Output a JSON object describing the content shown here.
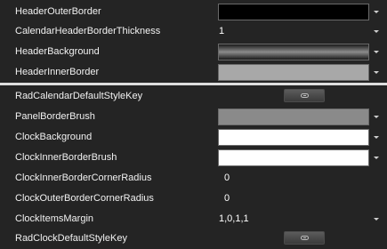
{
  "rows": [
    {
      "label": "HeaderOuterBorder",
      "kind": "swatch",
      "color": "#000000"
    },
    {
      "label": "CalendarHeaderBorderThickness",
      "kind": "text",
      "value": "1"
    },
    {
      "label": "HeaderBackground",
      "kind": "gradient"
    },
    {
      "label": "HeaderInnerBorder",
      "kind": "swatch",
      "color": "#a8a8a8"
    },
    {
      "label": "RadCalendarDefaultStyleKey",
      "kind": "link"
    },
    {
      "label": "PanelBorderBrush",
      "kind": "swatch",
      "color": "#8a8a8a"
    },
    {
      "label": "ClockBackground",
      "kind": "swatch",
      "color": "#ffffff"
    },
    {
      "label": "ClockInnerBorderBrush",
      "kind": "swatch",
      "color": "#ffffff"
    },
    {
      "label": "ClockInnerBorderCornerRadius",
      "kind": "text",
      "value": "0"
    },
    {
      "label": "ClockOuterBorderCornerRadius",
      "kind": "text",
      "value": "0"
    },
    {
      "label": "ClockItemsMargin",
      "kind": "text",
      "value": "1,0,1,1"
    },
    {
      "label": "RadClockDefaultStyleKey",
      "kind": "link"
    }
  ]
}
